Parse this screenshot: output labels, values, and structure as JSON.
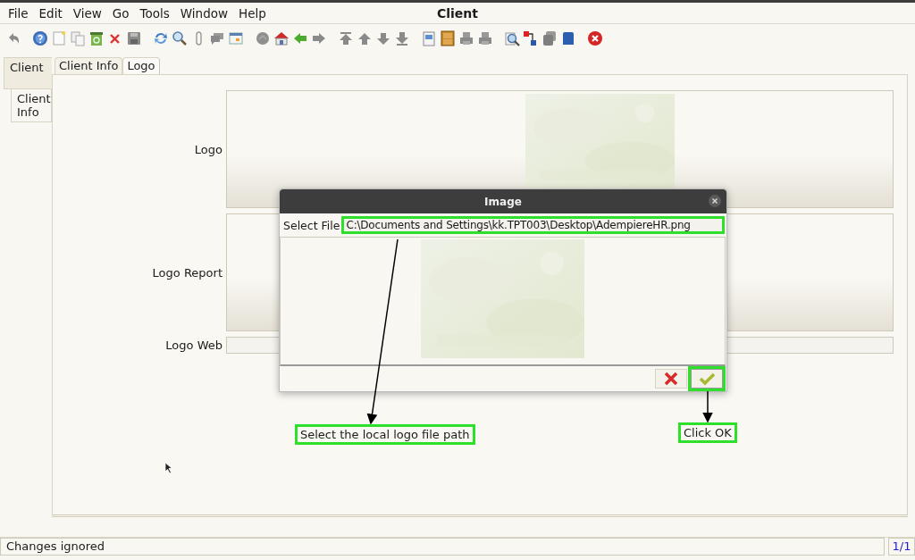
{
  "window": {
    "title": "Client"
  },
  "menu": [
    {
      "label": "File"
    },
    {
      "label": "Edit"
    },
    {
      "label": "View"
    },
    {
      "label": "Go"
    },
    {
      "label": "Tools"
    },
    {
      "label": "Window"
    },
    {
      "label": "Help"
    }
  ],
  "side_tabs": [
    {
      "label": "Client",
      "selected": true
    },
    {
      "label": "Client Info",
      "selected": false
    }
  ],
  "tabs": [
    {
      "label": "Client Info",
      "selected": false
    },
    {
      "label": "Logo",
      "selected": true
    }
  ],
  "fields": [
    {
      "label": "Logo"
    },
    {
      "label": "Logo Report"
    },
    {
      "label": "Logo Web",
      "kind": "text"
    }
  ],
  "dialog": {
    "title": "Image",
    "file_label": "Select File",
    "file_value": "C:\\Documents and Settings\\kk.TPT003\\Desktop\\AdempiereHR.png",
    "file_highlighted": true,
    "ok_highlighted": true
  },
  "callouts": [
    {
      "text": "Select the local logo file path"
    },
    {
      "text": "Click OK"
    }
  ],
  "status_bar": {
    "message": "Changes ignored",
    "count": "1/1"
  }
}
